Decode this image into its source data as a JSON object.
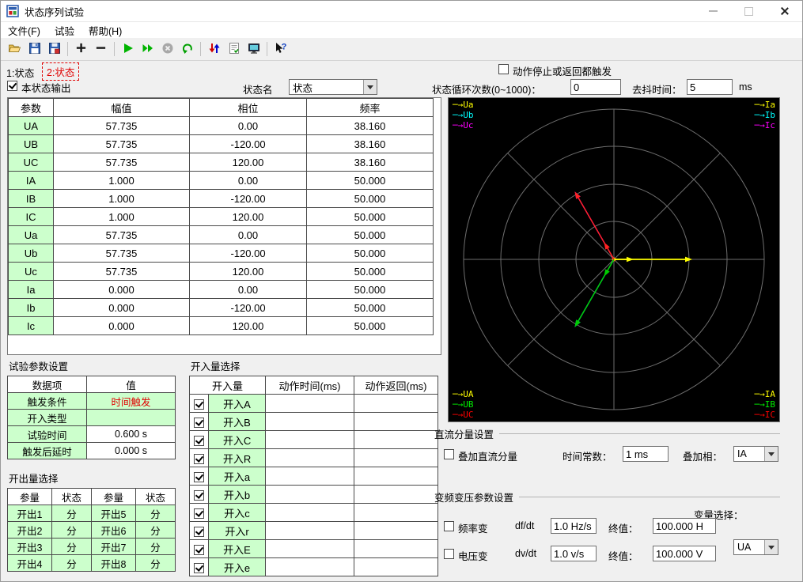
{
  "window": {
    "title": "状态序列试验"
  },
  "menu": {
    "items": [
      {
        "label": "文件(F)"
      },
      {
        "label": "试验"
      },
      {
        "label": "帮助(H)"
      }
    ]
  },
  "toolbar": {
    "icons": [
      "open-icon",
      "save-icon",
      "save-report-icon",
      "add-state-icon",
      "remove-state-icon",
      "run-icon",
      "run-continuous-icon",
      "stop-icon",
      "undo-icon",
      "io-transfer-icon",
      "report-icon",
      "display-icon",
      "help-icon"
    ]
  },
  "tabs": [
    {
      "label": "1:状态",
      "active": false
    },
    {
      "label": "2:状态",
      "active": true
    }
  ],
  "state_controls": {
    "output_label": "本状态输出",
    "output_checked": true,
    "name_label": "状态名",
    "name_value": "状态",
    "trigger_label": "动作停止或返回都触发",
    "trigger_checked": false,
    "loop_label": "状态循环次数(0~1000)：",
    "loop_value": "0",
    "debounce_label": "去抖时间：",
    "debounce_value": "5",
    "debounce_unit": "ms"
  },
  "param_table": {
    "headers": [
      "参数",
      "幅值",
      "相位",
      "频率"
    ],
    "rows": [
      {
        "name": "UA",
        "amp": "57.735",
        "phase": "0.00",
        "freq": "38.160"
      },
      {
        "name": "UB",
        "amp": "57.735",
        "phase": "-120.00",
        "freq": "38.160"
      },
      {
        "name": "UC",
        "amp": "57.735",
        "phase": "120.00",
        "freq": "38.160"
      },
      {
        "name": "IA",
        "amp": "1.000",
        "phase": "0.00",
        "freq": "50.000"
      },
      {
        "name": "IB",
        "amp": "1.000",
        "phase": "-120.00",
        "freq": "50.000"
      },
      {
        "name": "IC",
        "amp": "1.000",
        "phase": "120.00",
        "freq": "50.000"
      },
      {
        "name": "Ua",
        "amp": "57.735",
        "phase": "0.00",
        "freq": "50.000"
      },
      {
        "name": "Ub",
        "amp": "57.735",
        "phase": "-120.00",
        "freq": "50.000"
      },
      {
        "name": "Uc",
        "amp": "57.735",
        "phase": "120.00",
        "freq": "50.000"
      },
      {
        "name": "Ia",
        "amp": "0.000",
        "phase": "0.00",
        "freq": "50.000"
      },
      {
        "name": "Ib",
        "amp": "0.000",
        "phase": "-120.00",
        "freq": "50.000"
      },
      {
        "name": "Ic",
        "amp": "0.000",
        "phase": "120.00",
        "freq": "50.000"
      }
    ]
  },
  "phasor": {
    "legend_topleft": [
      {
        "label": "Ua",
        "color": "#ffff00"
      },
      {
        "label": "Ub",
        "color": "#00ffff"
      },
      {
        "label": "Uc",
        "color": "#ff00ff"
      }
    ],
    "legend_topright": [
      {
        "label": "Ia",
        "color": "#ffff00"
      },
      {
        "label": "Ib",
        "color": "#00ffff"
      },
      {
        "label": "Ic",
        "color": "#ff00ff"
      }
    ],
    "legend_bottomleft": [
      {
        "label": "UA",
        "color": "#ffff00"
      },
      {
        "label": "UB",
        "color": "#00ee00"
      },
      {
        "label": "UC",
        "color": "#ff0000"
      }
    ],
    "legend_bottomright": [
      {
        "label": "IA",
        "color": "#ffff00"
      },
      {
        "label": "IB",
        "color": "#00ee00"
      },
      {
        "label": "IC",
        "color": "#ff0000"
      }
    ],
    "vectors": [
      {
        "name": "Ua",
        "color": "#ffff00",
        "angle": 0,
        "len": 90
      },
      {
        "name": "Ub",
        "color": "#00ffff",
        "angle": -120,
        "len": 90
      },
      {
        "name": "Uc",
        "color": "#ff00ff",
        "angle": 120,
        "len": 90
      },
      {
        "name": "UA",
        "color": "#ffff00",
        "angle": 0,
        "len": 90
      },
      {
        "name": "UB",
        "color": "#00cc00",
        "angle": -120,
        "len": 90
      },
      {
        "name": "UC",
        "color": "#ff2222",
        "angle": 120,
        "len": 90
      },
      {
        "name": "IA",
        "color": "#ffff00",
        "angle": 0,
        "len": 16
      },
      {
        "name": "IB",
        "color": "#00cc00",
        "angle": -120,
        "len": 16
      },
      {
        "name": "IC",
        "color": "#ff2222",
        "angle": 120,
        "len": 16
      }
    ]
  },
  "test_params": {
    "title": "试验参数设置",
    "headers": [
      "数据项",
      "值"
    ],
    "rows": [
      {
        "name": "触发条件",
        "value": "时间触发"
      },
      {
        "name": "开入类型",
        "value": ""
      },
      {
        "name": "试验时间",
        "value": "0.600 s"
      },
      {
        "name": "触发后延时",
        "value": "0.000 s"
      }
    ]
  },
  "binary_outputs": {
    "title": "开出量选择",
    "headers": [
      "参量",
      "状态",
      "参量",
      "状态"
    ],
    "rows": [
      {
        "n1": "开出1",
        "s1": "分",
        "n2": "开出5",
        "s2": "分"
      },
      {
        "n1": "开出2",
        "s1": "分",
        "n2": "开出6",
        "s2": "分"
      },
      {
        "n1": "开出3",
        "s1": "分",
        "n2": "开出7",
        "s2": "分"
      },
      {
        "n1": "开出4",
        "s1": "分",
        "n2": "开出8",
        "s2": "分"
      }
    ]
  },
  "binary_inputs": {
    "title": "开入量选择",
    "headers": [
      "开入量",
      "动作时间(ms)",
      "动作返回(ms)"
    ],
    "rows": [
      {
        "name": "开入A",
        "checked": true,
        "time": "",
        "ret": ""
      },
      {
        "name": "开入B",
        "checked": true,
        "time": "",
        "ret": ""
      },
      {
        "name": "开入C",
        "checked": true,
        "time": "",
        "ret": ""
      },
      {
        "name": "开入R",
        "checked": true,
        "time": "",
        "ret": ""
      },
      {
        "name": "开入a",
        "checked": true,
        "time": "",
        "ret": ""
      },
      {
        "name": "开入b",
        "checked": true,
        "time": "",
        "ret": ""
      },
      {
        "name": "开入c",
        "checked": true,
        "time": "",
        "ret": ""
      },
      {
        "name": "开入r",
        "checked": true,
        "time": "",
        "ret": ""
      },
      {
        "name": "开入E",
        "checked": true,
        "time": "",
        "ret": ""
      },
      {
        "name": "开入e",
        "checked": true,
        "time": "",
        "ret": ""
      }
    ]
  },
  "dc_settings": {
    "title": "直流分量设置",
    "superimpose_label": "叠加直流分量",
    "superimpose_checked": false,
    "time_const_label": "时间常数：",
    "time_const_value": "1 ms",
    "phase_label": "叠加相：",
    "phase_value": "IA"
  },
  "vf_settings": {
    "title": "变频变压参数设置",
    "variable_label": "变量选择：",
    "variable_value": "UA",
    "freq_label": "频率变",
    "freq_checked": false,
    "dfdt_label": "df/dt",
    "dfdt_value": "1.0 Hz/s",
    "freq_final_label": "终值：",
    "freq_final_value": "100.000 H",
    "volt_label": "电压变",
    "volt_checked": false,
    "dvdt_label": "dv/dt",
    "dvdt_value": "1.0 v/s",
    "volt_final_label": "终值：",
    "volt_final_value": "100.000 V"
  }
}
